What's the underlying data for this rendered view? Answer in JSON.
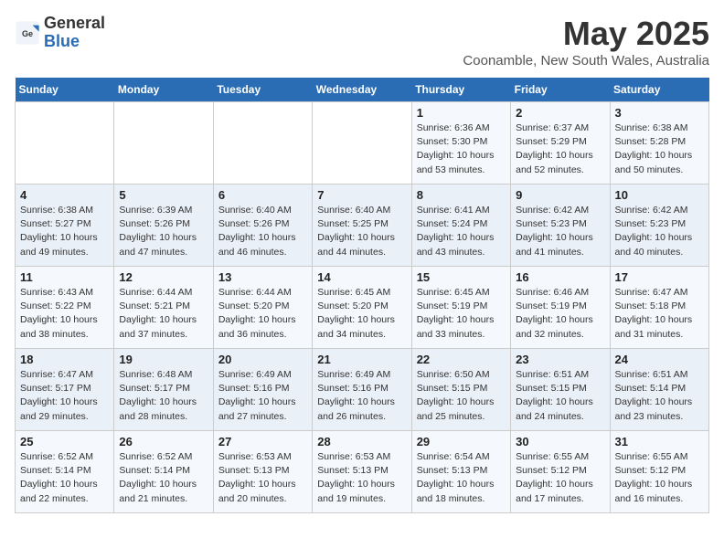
{
  "logo": {
    "general": "General",
    "blue": "Blue"
  },
  "header": {
    "month_year": "May 2025",
    "location": "Coonamble, New South Wales, Australia"
  },
  "days_of_week": [
    "Sunday",
    "Monday",
    "Tuesday",
    "Wednesday",
    "Thursday",
    "Friday",
    "Saturday"
  ],
  "weeks": [
    [
      {
        "day": "",
        "info": ""
      },
      {
        "day": "",
        "info": ""
      },
      {
        "day": "",
        "info": ""
      },
      {
        "day": "",
        "info": ""
      },
      {
        "day": "1",
        "info": "Sunrise: 6:36 AM\nSunset: 5:30 PM\nDaylight: 10 hours\nand 53 minutes."
      },
      {
        "day": "2",
        "info": "Sunrise: 6:37 AM\nSunset: 5:29 PM\nDaylight: 10 hours\nand 52 minutes."
      },
      {
        "day": "3",
        "info": "Sunrise: 6:38 AM\nSunset: 5:28 PM\nDaylight: 10 hours\nand 50 minutes."
      }
    ],
    [
      {
        "day": "4",
        "info": "Sunrise: 6:38 AM\nSunset: 5:27 PM\nDaylight: 10 hours\nand 49 minutes."
      },
      {
        "day": "5",
        "info": "Sunrise: 6:39 AM\nSunset: 5:26 PM\nDaylight: 10 hours\nand 47 minutes."
      },
      {
        "day": "6",
        "info": "Sunrise: 6:40 AM\nSunset: 5:26 PM\nDaylight: 10 hours\nand 46 minutes."
      },
      {
        "day": "7",
        "info": "Sunrise: 6:40 AM\nSunset: 5:25 PM\nDaylight: 10 hours\nand 44 minutes."
      },
      {
        "day": "8",
        "info": "Sunrise: 6:41 AM\nSunset: 5:24 PM\nDaylight: 10 hours\nand 43 minutes."
      },
      {
        "day": "9",
        "info": "Sunrise: 6:42 AM\nSunset: 5:23 PM\nDaylight: 10 hours\nand 41 minutes."
      },
      {
        "day": "10",
        "info": "Sunrise: 6:42 AM\nSunset: 5:23 PM\nDaylight: 10 hours\nand 40 minutes."
      }
    ],
    [
      {
        "day": "11",
        "info": "Sunrise: 6:43 AM\nSunset: 5:22 PM\nDaylight: 10 hours\nand 38 minutes."
      },
      {
        "day": "12",
        "info": "Sunrise: 6:44 AM\nSunset: 5:21 PM\nDaylight: 10 hours\nand 37 minutes."
      },
      {
        "day": "13",
        "info": "Sunrise: 6:44 AM\nSunset: 5:20 PM\nDaylight: 10 hours\nand 36 minutes."
      },
      {
        "day": "14",
        "info": "Sunrise: 6:45 AM\nSunset: 5:20 PM\nDaylight: 10 hours\nand 34 minutes."
      },
      {
        "day": "15",
        "info": "Sunrise: 6:45 AM\nSunset: 5:19 PM\nDaylight: 10 hours\nand 33 minutes."
      },
      {
        "day": "16",
        "info": "Sunrise: 6:46 AM\nSunset: 5:19 PM\nDaylight: 10 hours\nand 32 minutes."
      },
      {
        "day": "17",
        "info": "Sunrise: 6:47 AM\nSunset: 5:18 PM\nDaylight: 10 hours\nand 31 minutes."
      }
    ],
    [
      {
        "day": "18",
        "info": "Sunrise: 6:47 AM\nSunset: 5:17 PM\nDaylight: 10 hours\nand 29 minutes."
      },
      {
        "day": "19",
        "info": "Sunrise: 6:48 AM\nSunset: 5:17 PM\nDaylight: 10 hours\nand 28 minutes."
      },
      {
        "day": "20",
        "info": "Sunrise: 6:49 AM\nSunset: 5:16 PM\nDaylight: 10 hours\nand 27 minutes."
      },
      {
        "day": "21",
        "info": "Sunrise: 6:49 AM\nSunset: 5:16 PM\nDaylight: 10 hours\nand 26 minutes."
      },
      {
        "day": "22",
        "info": "Sunrise: 6:50 AM\nSunset: 5:15 PM\nDaylight: 10 hours\nand 25 minutes."
      },
      {
        "day": "23",
        "info": "Sunrise: 6:51 AM\nSunset: 5:15 PM\nDaylight: 10 hours\nand 24 minutes."
      },
      {
        "day": "24",
        "info": "Sunrise: 6:51 AM\nSunset: 5:14 PM\nDaylight: 10 hours\nand 23 minutes."
      }
    ],
    [
      {
        "day": "25",
        "info": "Sunrise: 6:52 AM\nSunset: 5:14 PM\nDaylight: 10 hours\nand 22 minutes."
      },
      {
        "day": "26",
        "info": "Sunrise: 6:52 AM\nSunset: 5:14 PM\nDaylight: 10 hours\nand 21 minutes."
      },
      {
        "day": "27",
        "info": "Sunrise: 6:53 AM\nSunset: 5:13 PM\nDaylight: 10 hours\nand 20 minutes."
      },
      {
        "day": "28",
        "info": "Sunrise: 6:53 AM\nSunset: 5:13 PM\nDaylight: 10 hours\nand 19 minutes."
      },
      {
        "day": "29",
        "info": "Sunrise: 6:54 AM\nSunset: 5:13 PM\nDaylight: 10 hours\nand 18 minutes."
      },
      {
        "day": "30",
        "info": "Sunrise: 6:55 AM\nSunset: 5:12 PM\nDaylight: 10 hours\nand 17 minutes."
      },
      {
        "day": "31",
        "info": "Sunrise: 6:55 AM\nSunset: 5:12 PM\nDaylight: 10 hours\nand 16 minutes."
      }
    ]
  ]
}
